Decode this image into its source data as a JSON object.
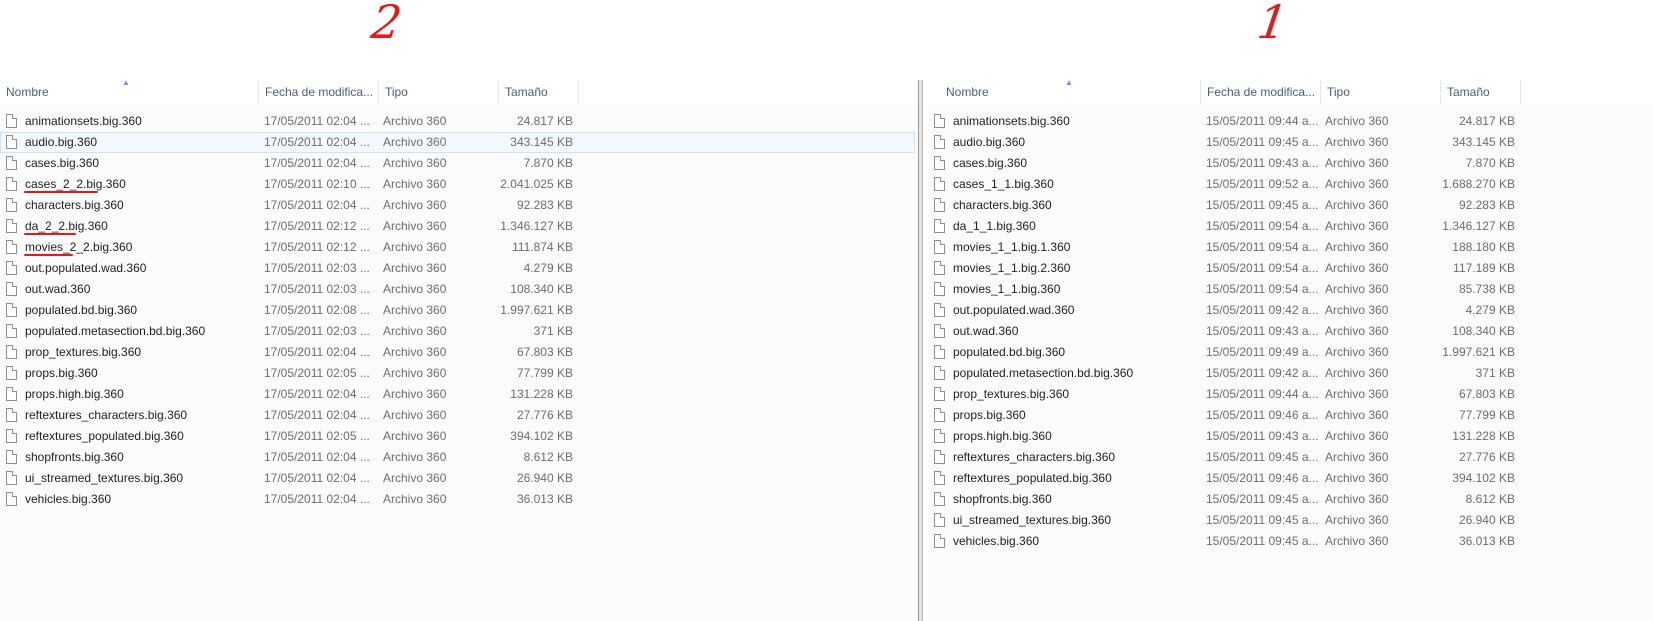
{
  "labels": {
    "left": "2",
    "right": "1"
  },
  "columns": {
    "name": "Nombre",
    "date": "Fecha de modifica...",
    "type": "Tipo",
    "size": "Tamaño"
  },
  "accent": "#569de5",
  "annotation_color": "#e11b1b",
  "left_pane": {
    "files": [
      {
        "name": "animationsets.big.360",
        "date": "17/05/2011 02:04 ...",
        "type": "Archivo 360",
        "size": "24.817 KB"
      },
      {
        "name": "audio.big.360",
        "date": "17/05/2011 02:04 ...",
        "type": "Archivo 360",
        "size": "343.145 KB",
        "selected": true
      },
      {
        "name": "cases.big.360",
        "date": "17/05/2011 02:04 ...",
        "type": "Archivo 360",
        "size": "7.870 KB"
      },
      {
        "name": "cases_2_2.big.360",
        "date": "17/05/2011 02:10 ...",
        "type": "Archivo 360",
        "size": "2.041.025 KB",
        "underlined": true
      },
      {
        "name": "characters.big.360",
        "date": "17/05/2011 02:04 ...",
        "type": "Archivo 360",
        "size": "92.283 KB"
      },
      {
        "name": "da_2_2.big.360",
        "date": "17/05/2011 02:12 ...",
        "type": "Archivo 360",
        "size": "1.346.127 KB",
        "underlined": true
      },
      {
        "name": "movies_2_2.big.360",
        "date": "17/05/2011 02:12 ...",
        "type": "Archivo 360",
        "size": "111.874 KB",
        "underlined": true
      },
      {
        "name": "out.populated.wad.360",
        "date": "17/05/2011 02:03 ...",
        "type": "Archivo 360",
        "size": "4.279 KB"
      },
      {
        "name": "out.wad.360",
        "date": "17/05/2011 02:03 ...",
        "type": "Archivo 360",
        "size": "108.340 KB"
      },
      {
        "name": "populated.bd.big.360",
        "date": "17/05/2011 02:08 ...",
        "type": "Archivo 360",
        "size": "1.997.621 KB"
      },
      {
        "name": "populated.metasection.bd.big.360",
        "date": "17/05/2011 02:03 ...",
        "type": "Archivo 360",
        "size": "371 KB"
      },
      {
        "name": "prop_textures.big.360",
        "date": "17/05/2011 02:04 ...",
        "type": "Archivo 360",
        "size": "67.803 KB"
      },
      {
        "name": "props.big.360",
        "date": "17/05/2011 02:05 ...",
        "type": "Archivo 360",
        "size": "77.799 KB"
      },
      {
        "name": "props.high.big.360",
        "date": "17/05/2011 02:04 ...",
        "type": "Archivo 360",
        "size": "131.228 KB"
      },
      {
        "name": "reftextures_characters.big.360",
        "date": "17/05/2011 02:04 ...",
        "type": "Archivo 360",
        "size": "27.776 KB"
      },
      {
        "name": "reftextures_populated.big.360",
        "date": "17/05/2011 02:05 ...",
        "type": "Archivo 360",
        "size": "394.102 KB"
      },
      {
        "name": "shopfronts.big.360",
        "date": "17/05/2011 02:04 ...",
        "type": "Archivo 360",
        "size": "8.612 KB"
      },
      {
        "name": "ui_streamed_textures.big.360",
        "date": "17/05/2011 02:04 ...",
        "type": "Archivo 360",
        "size": "26.940 KB"
      },
      {
        "name": "vehicles.big.360",
        "date": "17/05/2011 02:04 ...",
        "type": "Archivo 360",
        "size": "36.013 KB"
      }
    ]
  },
  "right_pane": {
    "files": [
      {
        "name": "animationsets.big.360",
        "date": "15/05/2011 09:44 a...",
        "type": "Archivo 360",
        "size": "24.817 KB"
      },
      {
        "name": "audio.big.360",
        "date": "15/05/2011 09:45 a...",
        "type": "Archivo 360",
        "size": "343.145 KB"
      },
      {
        "name": "cases.big.360",
        "date": "15/05/2011 09:43 a...",
        "type": "Archivo 360",
        "size": "7.870 KB"
      },
      {
        "name": "cases_1_1.big.360",
        "date": "15/05/2011 09:52 a...",
        "type": "Archivo 360",
        "size": "1.688.270 KB"
      },
      {
        "name": "characters.big.360",
        "date": "15/05/2011 09:45 a...",
        "type": "Archivo 360",
        "size": "92.283 KB"
      },
      {
        "name": "da_1_1.big.360",
        "date": "15/05/2011 09:54 a...",
        "type": "Archivo 360",
        "size": "1.346.127 KB"
      },
      {
        "name": "movies_1_1.big.1.360",
        "date": "15/05/2011 09:54 a...",
        "type": "Archivo 360",
        "size": "188.180 KB"
      },
      {
        "name": "movies_1_1.big.2.360",
        "date": "15/05/2011 09:54 a...",
        "type": "Archivo 360",
        "size": "117.189 KB"
      },
      {
        "name": "movies_1_1.big.360",
        "date": "15/05/2011 09:54 a...",
        "type": "Archivo 360",
        "size": "85.738 KB"
      },
      {
        "name": "out.populated.wad.360",
        "date": "15/05/2011 09:42 a...",
        "type": "Archivo 360",
        "size": "4.279 KB"
      },
      {
        "name": "out.wad.360",
        "date": "15/05/2011 09:43 a...",
        "type": "Archivo 360",
        "size": "108.340 KB"
      },
      {
        "name": "populated.bd.big.360",
        "date": "15/05/2011 09:49 a...",
        "type": "Archivo 360",
        "size": "1.997.621 KB"
      },
      {
        "name": "populated.metasection.bd.big.360",
        "date": "15/05/2011 09:42 a...",
        "type": "Archivo 360",
        "size": "371 KB"
      },
      {
        "name": "prop_textures.big.360",
        "date": "15/05/2011 09:44 a...",
        "type": "Archivo 360",
        "size": "67.803 KB"
      },
      {
        "name": "props.big.360",
        "date": "15/05/2011 09:46 a...",
        "type": "Archivo 360",
        "size": "77.799 KB"
      },
      {
        "name": "props.high.big.360",
        "date": "15/05/2011 09:43 a...",
        "type": "Archivo 360",
        "size": "131.228 KB"
      },
      {
        "name": "reftextures_characters.big.360",
        "date": "15/05/2011 09:45 a...",
        "type": "Archivo 360",
        "size": "27.776 KB"
      },
      {
        "name": "reftextures_populated.big.360",
        "date": "15/05/2011 09:46 a...",
        "type": "Archivo 360",
        "size": "394.102 KB"
      },
      {
        "name": "shopfronts.big.360",
        "date": "15/05/2011 09:45 a...",
        "type": "Archivo 360",
        "size": "8.612 KB"
      },
      {
        "name": "ui_streamed_textures.big.360",
        "date": "15/05/2011 09:45 a...",
        "type": "Archivo 360",
        "size": "26.940 KB"
      },
      {
        "name": "vehicles.big.360",
        "date": "15/05/2011 09:45 a...",
        "type": "Archivo 360",
        "size": "36.013 KB"
      }
    ]
  }
}
